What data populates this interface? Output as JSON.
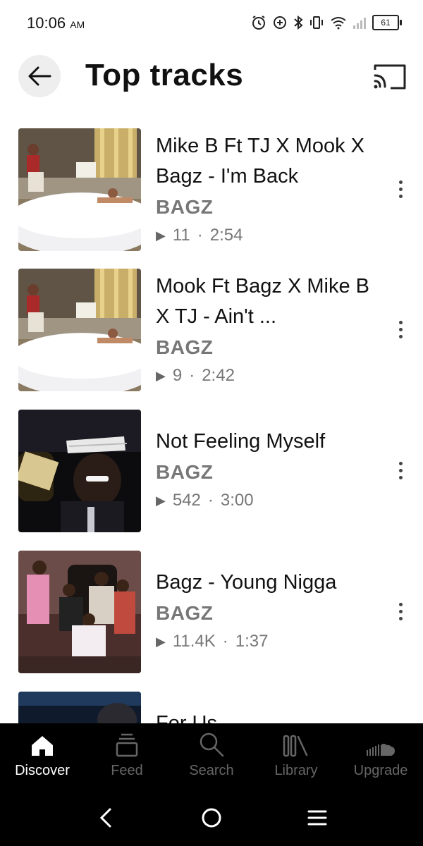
{
  "status_bar": {
    "time": "10:06",
    "ampm": "AM",
    "battery": "61"
  },
  "header": {
    "title": "Top tracks"
  },
  "tracks": [
    {
      "title": "Mike B Ft TJ X Mook X Bagz - I'm Back",
      "artist": "BAGZ",
      "plays": "11",
      "duration": "2:54",
      "sep": "·"
    },
    {
      "title": "Mook Ft Bagz X Mike B X TJ - Ain't ...",
      "artist": "BAGZ",
      "plays": "9",
      "duration": "2:42",
      "sep": "·"
    },
    {
      "title": "Not Feeling Myself",
      "artist": "BAGZ",
      "plays": "542",
      "duration": "3:00",
      "sep": "·"
    },
    {
      "title": "Bagz - Young Nigga",
      "artist": "BAGZ",
      "plays": "11.4K",
      "duration": "1:37",
      "sep": "·"
    },
    {
      "title": "For Us",
      "artist": "",
      "plays": "",
      "duration": "",
      "sep": ""
    }
  ],
  "nav": {
    "discover": "Discover",
    "feed": "Feed",
    "search": "Search",
    "library": "Library",
    "upgrade": "Upgrade"
  },
  "colors": {
    "nav_bg": "#000000",
    "nav_active": "#ffffff",
    "nav_inactive": "#666666"
  }
}
